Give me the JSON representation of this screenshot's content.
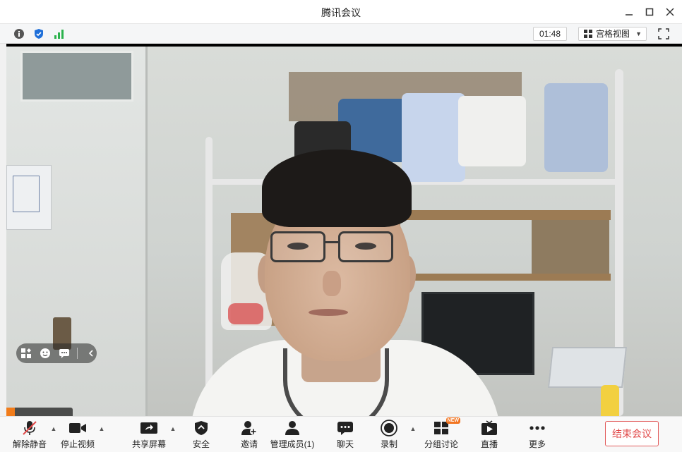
{
  "window": {
    "title": "腾讯会议"
  },
  "infobar": {
    "timer": "01:48",
    "view_mode": "宫格视图"
  },
  "colors": {
    "accent_blue": "#1e6fd9",
    "signal_green": "#2bb24c",
    "end_red": "#e14848",
    "new_badge": "#f27521"
  },
  "toolbar": {
    "items": [
      {
        "label": "解除静音",
        "icon": "mic-muted-icon"
      },
      {
        "label": "停止视频",
        "icon": "video-camera-icon"
      },
      {
        "label": "共享屏幕",
        "icon": "share-screen-icon"
      },
      {
        "label": "安全",
        "icon": "shield-icon"
      },
      {
        "label": "邀请",
        "icon": "add-user-icon"
      },
      {
        "label": "管理成员(1)",
        "icon": "members-icon"
      },
      {
        "label": "聊天",
        "icon": "chat-icon"
      },
      {
        "label": "录制",
        "icon": "record-icon"
      },
      {
        "label": "分组讨论",
        "icon": "breakout-rooms-icon",
        "badge": "NEW"
      },
      {
        "label": "直播",
        "icon": "live-stream-icon"
      },
      {
        "label": "更多",
        "icon": "more-dots-icon"
      }
    ],
    "end_label": "结束会议"
  }
}
